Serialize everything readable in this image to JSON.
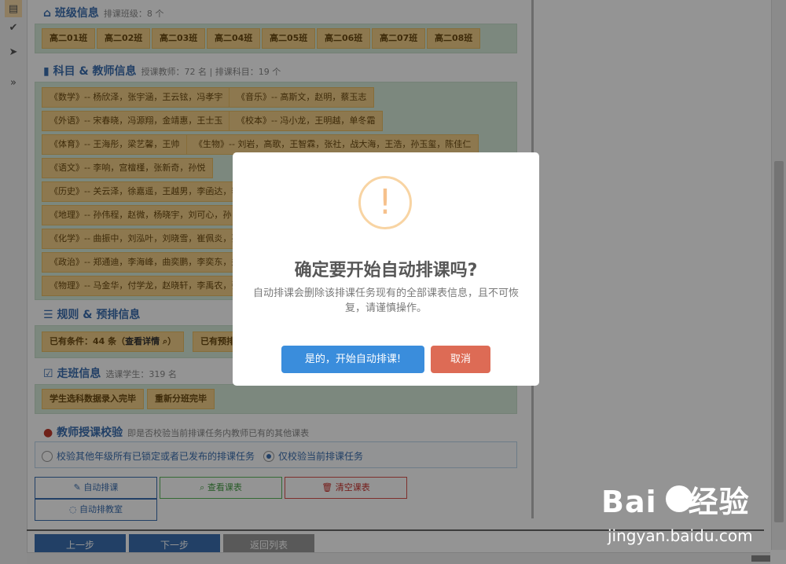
{
  "left_toolbar": {
    "icons": [
      "film-icon",
      "check-icon",
      "send-icon",
      "circle-arrow-right-icon"
    ]
  },
  "class_info": {
    "title": "班级信息",
    "subtitle": "排课班级：8 个",
    "classes": [
      "高二01班",
      "高二02班",
      "高二03班",
      "高二04班",
      "高二05班",
      "高二06班",
      "高二07班",
      "高二08班"
    ]
  },
  "subject_info": {
    "title": "科目 & 教师信息",
    "subtitle": "授课教师：72 名 | 排课科目：19 个",
    "rows": [
      [
        "《数学》-- 杨欣泽，张宇涵，王云铉，冯孝宇",
        "《音乐》-- 高斯文，赵明，蔡玉志"
      ],
      [
        "《外语》-- 宋春晓，冯源翔，金靖惠，王士玉",
        "《校本》-- 冯小龙，王明越，单冬霜"
      ],
      [
        "《体育》-- 王海彤，梁艺馨，王帅",
        "《生物》-- 刘岩，高歌，王智霖，张社，战大海，王浩，孙玉玺，陈佳仁"
      ],
      [
        "《语文》-- 李响，宫檀槿，张新奇，孙悦"
      ],
      [
        "《历史》-- 关云泽，徐嘉遥，王越男，李函达，李"
      ],
      [
        "《地理》-- 孙伟程，赵微，杨晓宇，刘可心，孙"
      ],
      [
        "《化学》-- 曲振中，刘泓叶，刘晓雪，崔佩炎，孙"
      ],
      [
        "《政治》-- 郑通迪，李海峰，曲奕鹏，李奕东，郑"
      ],
      [
        "《物理》-- 马金华，付学龙，赵晓轩，李禹农，张"
      ]
    ]
  },
  "rules_info": {
    "title": "规则 & 预排信息",
    "condition_text": "已有条件：44 条（",
    "details_link": "查看详情",
    "condition_close": "）",
    "preset_text": "已有预排"
  },
  "walk_info": {
    "title": "走班信息",
    "subtitle": "选课学生：319 名",
    "tags": [
      "学生选科数据录入完毕",
      "重新分班完毕"
    ]
  },
  "teacher_check": {
    "title": "教师授课校验",
    "subtitle": "即是否校验当前排课任务内教师已有的其他课表",
    "options": [
      {
        "label": "校验其他年级所有已锁定或者已发布的排课任务",
        "selected": false
      },
      {
        "label": "仅校验当前排课任务",
        "selected": true
      }
    ]
  },
  "actions": {
    "auto_schedule": "自动排课",
    "view_schedule": "查看课表",
    "clear_schedule": "清空课表",
    "auto_classroom": "自动排教室"
  },
  "nav": {
    "prev": "上一步",
    "next": "下一步",
    "back": "返回列表"
  },
  "dialog": {
    "title": "确定要开始自动排课吗?",
    "message": "自动排课会删除该排课任务现有的全部课表信息，且不可恢复，请谨慎操作。",
    "confirm": "是的，开始自动排课!",
    "cancel": "取消",
    "icon_glyph": "!"
  },
  "watermark": {
    "brand": "Bai",
    "brand2": "经验",
    "url": "jingyan.baidu.com"
  },
  "colors": {
    "accent": "#3c6fb0",
    "tag_bg": "#f3cf88",
    "panel_bg": "#d6ebd9",
    "confirm": "#3a8ddc",
    "cancel": "#dd6b55"
  }
}
